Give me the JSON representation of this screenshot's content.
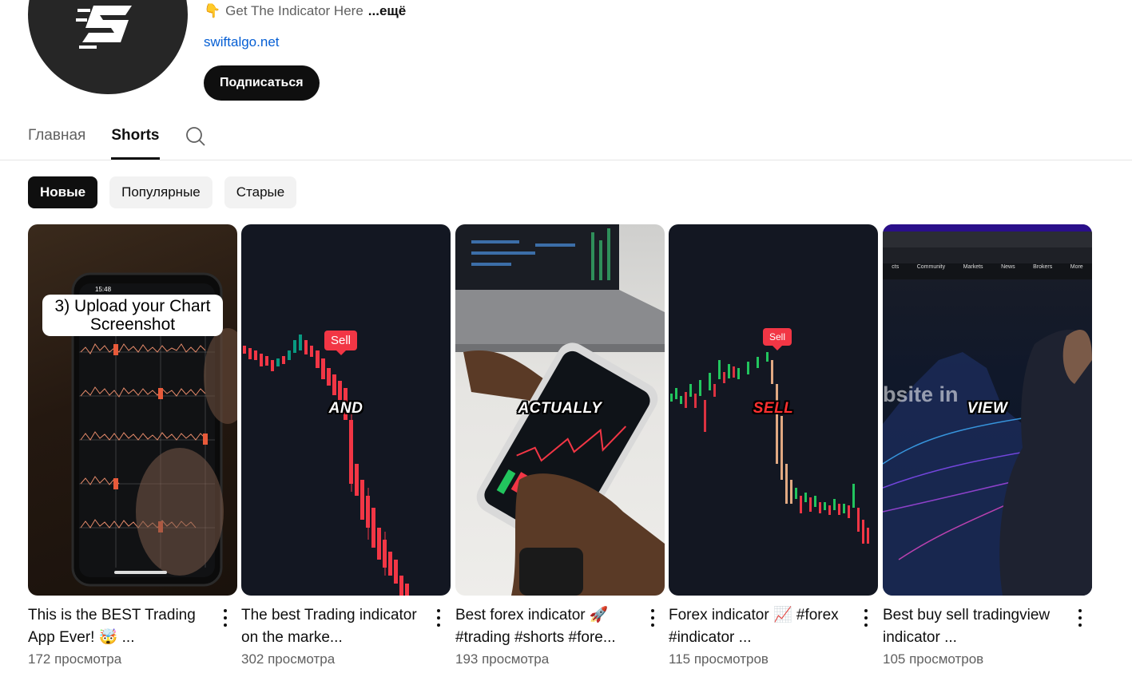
{
  "channel": {
    "description": "Get The Indicator Here",
    "description_emoji": "👇",
    "more_label": "...ещё",
    "link": "swiftalgo.net",
    "subscribe_label": "Подписаться"
  },
  "tabs": [
    {
      "label": "Главная",
      "active": false
    },
    {
      "label": "Shorts",
      "active": true
    }
  ],
  "chips": [
    {
      "label": "Новые",
      "active": true
    },
    {
      "label": "Популярные",
      "active": false
    },
    {
      "label": "Старые",
      "active": false
    }
  ],
  "videos": [
    {
      "title": "This is the BEST Trading App Ever! 🤯 ...",
      "views": "172 просмотра",
      "overlay_caption": "3) Upload your Chart Screenshot",
      "phone_time": "15:48"
    },
    {
      "title": "The best Trading indicator on the marke...",
      "views": "302 просмотра",
      "overlay_word": "AND",
      "badge": "Sell"
    },
    {
      "title": "Best forex indicator 🚀 #trading #shorts #fore...",
      "views": "193 просмотра",
      "overlay_word": "ACTUALLY"
    },
    {
      "title": "Forex indicator 📈 #forex #indicator ...",
      "views": "115 просмотров",
      "overlay_word": "SELL",
      "badge": "Sell"
    },
    {
      "title": "Best buy sell tradingview indicator ...",
      "views": "105 просмотров",
      "overlay_word": "VIEW",
      "overlay_fragment": "bsite in",
      "nav_items": [
        "cts",
        "Community",
        "Markets",
        "News",
        "Brokers",
        "More"
      ]
    }
  ],
  "colors": {
    "link": "#065fd4",
    "sell_red": "#f23645",
    "candle_green": "#22c55e",
    "chip_active": "#0f0f0f"
  }
}
